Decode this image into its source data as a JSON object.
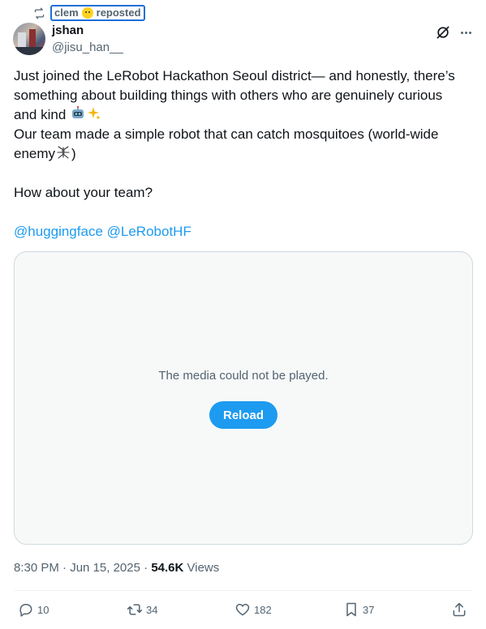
{
  "repost": {
    "icon": "repost-icon",
    "user": "clem",
    "label": "reposted"
  },
  "author": {
    "display_name": "jshan",
    "handle": "@jisu_han__"
  },
  "header_icons": [
    "grok-icon",
    "more-icon"
  ],
  "tweet": {
    "line1": "Just joined the LeRobot Hackathon Seoul district— and honestly, there’s",
    "line2": "something about building things with others who are genuinely curious",
    "line3": "and kind ",
    "line4": "Our team made a simple robot that can catch mosquitoes (world-wide",
    "line5_pre": "enemy",
    "line5_post": ")",
    "line6": "How about your team?",
    "mention1": "@huggingface",
    "mention2": "@LeRobotHF"
  },
  "media": {
    "message": "The media could not be played.",
    "reload_label": "Reload"
  },
  "meta": {
    "time": "8:30 PM",
    "date": "Jun 15, 2025",
    "separator": " · ",
    "views_count": "54.6K",
    "views_label": "Views"
  },
  "actions": {
    "replies": "10",
    "reposts": "34",
    "likes": "182",
    "bookmarks": "37"
  },
  "colors": {
    "accent": "#1d9bf0",
    "text": "#0f1419",
    "muted": "#536471"
  }
}
